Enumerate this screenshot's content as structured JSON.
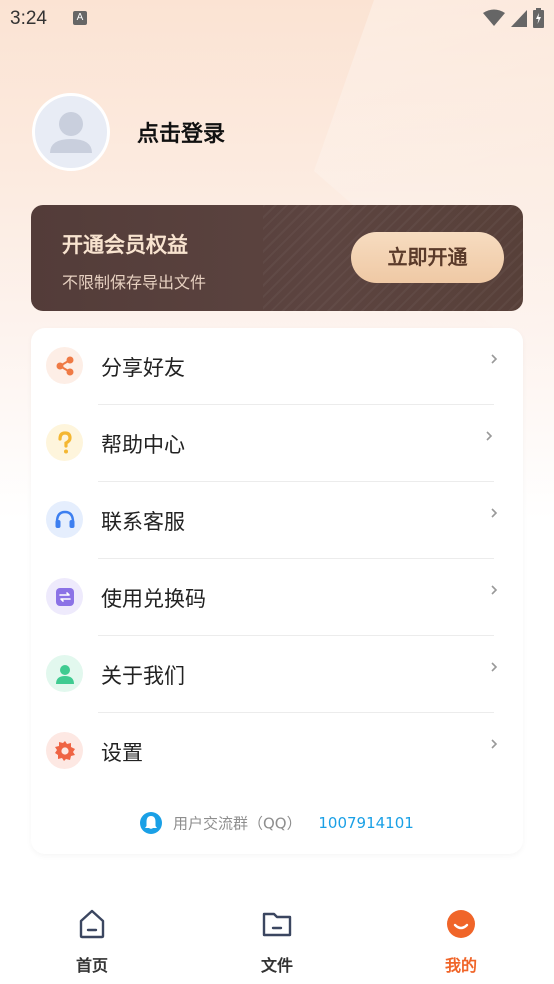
{
  "status_bar": {
    "time": "3:24",
    "notification_glyph": "A"
  },
  "profile": {
    "login_text": "点击登录"
  },
  "vip_banner": {
    "title": "开通会员权益",
    "subtitle": "不限制保存导出文件",
    "button_label": "立即开通"
  },
  "menu": {
    "items": [
      {
        "label": "分享好友",
        "icon": "share-icon",
        "color": "#ef7a45",
        "bg": "#fdeee6"
      },
      {
        "label": "帮助中心",
        "icon": "help-icon",
        "color": "#f4b731",
        "bg": "#fef5dc"
      },
      {
        "label": "联系客服",
        "icon": "headset-icon",
        "color": "#3d7ff0",
        "bg": "#e5eefd"
      },
      {
        "label": "使用兑换码",
        "icon": "exchange-icon",
        "color": "#8b72e6",
        "bg": "#eeeafc"
      },
      {
        "label": "关于我们",
        "icon": "person-icon",
        "color": "#3fcb91",
        "bg": "#e2f8ee"
      },
      {
        "label": "设置",
        "icon": "gear-icon",
        "color": "#ef6444",
        "bg": "#fde8e3"
      }
    ],
    "qq_group_label": "用户交流群（QQ）",
    "qq_group_number": "1007914101"
  },
  "bottom_nav": {
    "items": [
      {
        "label": "首页",
        "icon": "home-icon",
        "active": false
      },
      {
        "label": "文件",
        "icon": "folder-icon",
        "active": false
      },
      {
        "label": "我的",
        "icon": "profile-face-icon",
        "active": true
      }
    ],
    "active_color": "#f06529"
  }
}
